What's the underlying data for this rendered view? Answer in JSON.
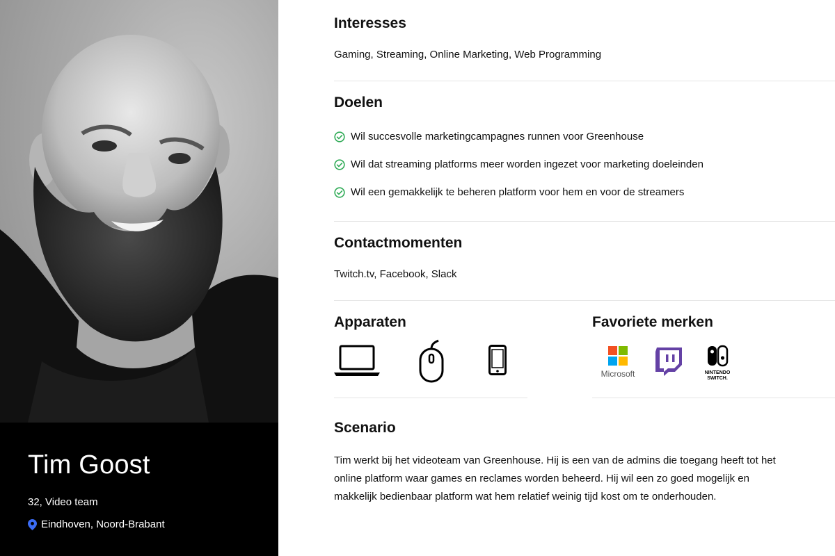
{
  "persona": {
    "name": "Tim Goost",
    "age_role": "32, Video team",
    "location": "Eindhoven, Noord-Brabant"
  },
  "sections": {
    "interests": {
      "title": "Interesses",
      "text": "Gaming, Streaming, Online Marketing, Web Programming"
    },
    "goals": {
      "title": "Doelen",
      "items": [
        "Wil succesvolle marketingcampagnes runnen voor Greenhouse",
        "Wil dat streaming platforms meer worden ingezet voor marketing doeleinden",
        "Wil een gemakkelijk te beheren platform voor hem en voor de streamers"
      ]
    },
    "contact": {
      "title": "Contactmomenten",
      "text": "Twitch.tv, Facebook, Slack"
    },
    "devices": {
      "title": "Apparaten",
      "items": [
        "laptop-icon",
        "mouse-icon",
        "smartphone-icon"
      ]
    },
    "brands": {
      "title": "Favoriete merken",
      "items": [
        {
          "icon": "microsoft-logo",
          "label": "Microsoft"
        },
        {
          "icon": "twitch-logo",
          "label": ""
        },
        {
          "icon": "nintendo-switch-logo",
          "label": "NINTENDO SWITCH."
        }
      ]
    },
    "scenario": {
      "title": "Scenario",
      "text": "Tim werkt bij het videoteam van Greenhouse. Hij is een van de admins die toegang heeft tot het online platform waar games en reclames worden beheerd. Hij wil een zo goed mogelijk en makkelijk bedienbaar platform wat hem relatief weinig tijd kost om te onderhouden."
    }
  },
  "colors": {
    "check": "#2eaa55",
    "pin": "#3b6cf5",
    "twitch": "#6441a5",
    "ms_red": "#f25022",
    "ms_green": "#7fba00",
    "ms_blue": "#00a4ef",
    "ms_yellow": "#ffb900"
  }
}
